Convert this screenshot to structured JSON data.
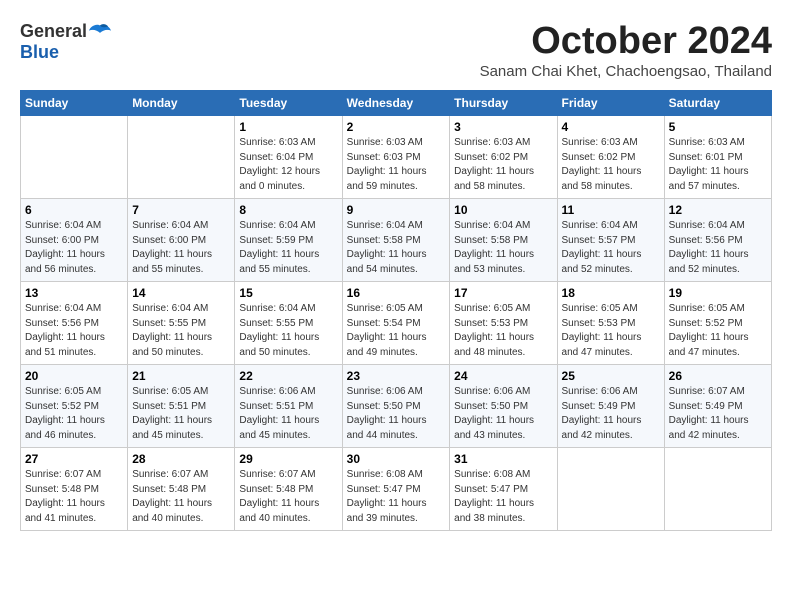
{
  "logo": {
    "general": "General",
    "blue": "Blue"
  },
  "title": "October 2024",
  "subtitle": "Sanam Chai Khet, Chachoengsao, Thailand",
  "days_header": [
    "Sunday",
    "Monday",
    "Tuesday",
    "Wednesday",
    "Thursday",
    "Friday",
    "Saturday"
  ],
  "weeks": [
    [
      null,
      null,
      {
        "day": "1",
        "sunrise": "Sunrise: 6:03 AM",
        "sunset": "Sunset: 6:04 PM",
        "daylight": "Daylight: 12 hours and 0 minutes."
      },
      {
        "day": "2",
        "sunrise": "Sunrise: 6:03 AM",
        "sunset": "Sunset: 6:03 PM",
        "daylight": "Daylight: 11 hours and 59 minutes."
      },
      {
        "day": "3",
        "sunrise": "Sunrise: 6:03 AM",
        "sunset": "Sunset: 6:02 PM",
        "daylight": "Daylight: 11 hours and 58 minutes."
      },
      {
        "day": "4",
        "sunrise": "Sunrise: 6:03 AM",
        "sunset": "Sunset: 6:02 PM",
        "daylight": "Daylight: 11 hours and 58 minutes."
      },
      {
        "day": "5",
        "sunrise": "Sunrise: 6:03 AM",
        "sunset": "Sunset: 6:01 PM",
        "daylight": "Daylight: 11 hours and 57 minutes."
      }
    ],
    [
      {
        "day": "6",
        "sunrise": "Sunrise: 6:04 AM",
        "sunset": "Sunset: 6:00 PM",
        "daylight": "Daylight: 11 hours and 56 minutes."
      },
      {
        "day": "7",
        "sunrise": "Sunrise: 6:04 AM",
        "sunset": "Sunset: 6:00 PM",
        "daylight": "Daylight: 11 hours and 55 minutes."
      },
      {
        "day": "8",
        "sunrise": "Sunrise: 6:04 AM",
        "sunset": "Sunset: 5:59 PM",
        "daylight": "Daylight: 11 hours and 55 minutes."
      },
      {
        "day": "9",
        "sunrise": "Sunrise: 6:04 AM",
        "sunset": "Sunset: 5:58 PM",
        "daylight": "Daylight: 11 hours and 54 minutes."
      },
      {
        "day": "10",
        "sunrise": "Sunrise: 6:04 AM",
        "sunset": "Sunset: 5:58 PM",
        "daylight": "Daylight: 11 hours and 53 minutes."
      },
      {
        "day": "11",
        "sunrise": "Sunrise: 6:04 AM",
        "sunset": "Sunset: 5:57 PM",
        "daylight": "Daylight: 11 hours and 52 minutes."
      },
      {
        "day": "12",
        "sunrise": "Sunrise: 6:04 AM",
        "sunset": "Sunset: 5:56 PM",
        "daylight": "Daylight: 11 hours and 52 minutes."
      }
    ],
    [
      {
        "day": "13",
        "sunrise": "Sunrise: 6:04 AM",
        "sunset": "Sunset: 5:56 PM",
        "daylight": "Daylight: 11 hours and 51 minutes."
      },
      {
        "day": "14",
        "sunrise": "Sunrise: 6:04 AM",
        "sunset": "Sunset: 5:55 PM",
        "daylight": "Daylight: 11 hours and 50 minutes."
      },
      {
        "day": "15",
        "sunrise": "Sunrise: 6:04 AM",
        "sunset": "Sunset: 5:55 PM",
        "daylight": "Daylight: 11 hours and 50 minutes."
      },
      {
        "day": "16",
        "sunrise": "Sunrise: 6:05 AM",
        "sunset": "Sunset: 5:54 PM",
        "daylight": "Daylight: 11 hours and 49 minutes."
      },
      {
        "day": "17",
        "sunrise": "Sunrise: 6:05 AM",
        "sunset": "Sunset: 5:53 PM",
        "daylight": "Daylight: 11 hours and 48 minutes."
      },
      {
        "day": "18",
        "sunrise": "Sunrise: 6:05 AM",
        "sunset": "Sunset: 5:53 PM",
        "daylight": "Daylight: 11 hours and 47 minutes."
      },
      {
        "day": "19",
        "sunrise": "Sunrise: 6:05 AM",
        "sunset": "Sunset: 5:52 PM",
        "daylight": "Daylight: 11 hours and 47 minutes."
      }
    ],
    [
      {
        "day": "20",
        "sunrise": "Sunrise: 6:05 AM",
        "sunset": "Sunset: 5:52 PM",
        "daylight": "Daylight: 11 hours and 46 minutes."
      },
      {
        "day": "21",
        "sunrise": "Sunrise: 6:05 AM",
        "sunset": "Sunset: 5:51 PM",
        "daylight": "Daylight: 11 hours and 45 minutes."
      },
      {
        "day": "22",
        "sunrise": "Sunrise: 6:06 AM",
        "sunset": "Sunset: 5:51 PM",
        "daylight": "Daylight: 11 hours and 45 minutes."
      },
      {
        "day": "23",
        "sunrise": "Sunrise: 6:06 AM",
        "sunset": "Sunset: 5:50 PM",
        "daylight": "Daylight: 11 hours and 44 minutes."
      },
      {
        "day": "24",
        "sunrise": "Sunrise: 6:06 AM",
        "sunset": "Sunset: 5:50 PM",
        "daylight": "Daylight: 11 hours and 43 minutes."
      },
      {
        "day": "25",
        "sunrise": "Sunrise: 6:06 AM",
        "sunset": "Sunset: 5:49 PM",
        "daylight": "Daylight: 11 hours and 42 minutes."
      },
      {
        "day": "26",
        "sunrise": "Sunrise: 6:07 AM",
        "sunset": "Sunset: 5:49 PM",
        "daylight": "Daylight: 11 hours and 42 minutes."
      }
    ],
    [
      {
        "day": "27",
        "sunrise": "Sunrise: 6:07 AM",
        "sunset": "Sunset: 5:48 PM",
        "daylight": "Daylight: 11 hours and 41 minutes."
      },
      {
        "day": "28",
        "sunrise": "Sunrise: 6:07 AM",
        "sunset": "Sunset: 5:48 PM",
        "daylight": "Daylight: 11 hours and 40 minutes."
      },
      {
        "day": "29",
        "sunrise": "Sunrise: 6:07 AM",
        "sunset": "Sunset: 5:48 PM",
        "daylight": "Daylight: 11 hours and 40 minutes."
      },
      {
        "day": "30",
        "sunrise": "Sunrise: 6:08 AM",
        "sunset": "Sunset: 5:47 PM",
        "daylight": "Daylight: 11 hours and 39 minutes."
      },
      {
        "day": "31",
        "sunrise": "Sunrise: 6:08 AM",
        "sunset": "Sunset: 5:47 PM",
        "daylight": "Daylight: 11 hours and 38 minutes."
      },
      null,
      null
    ]
  ]
}
